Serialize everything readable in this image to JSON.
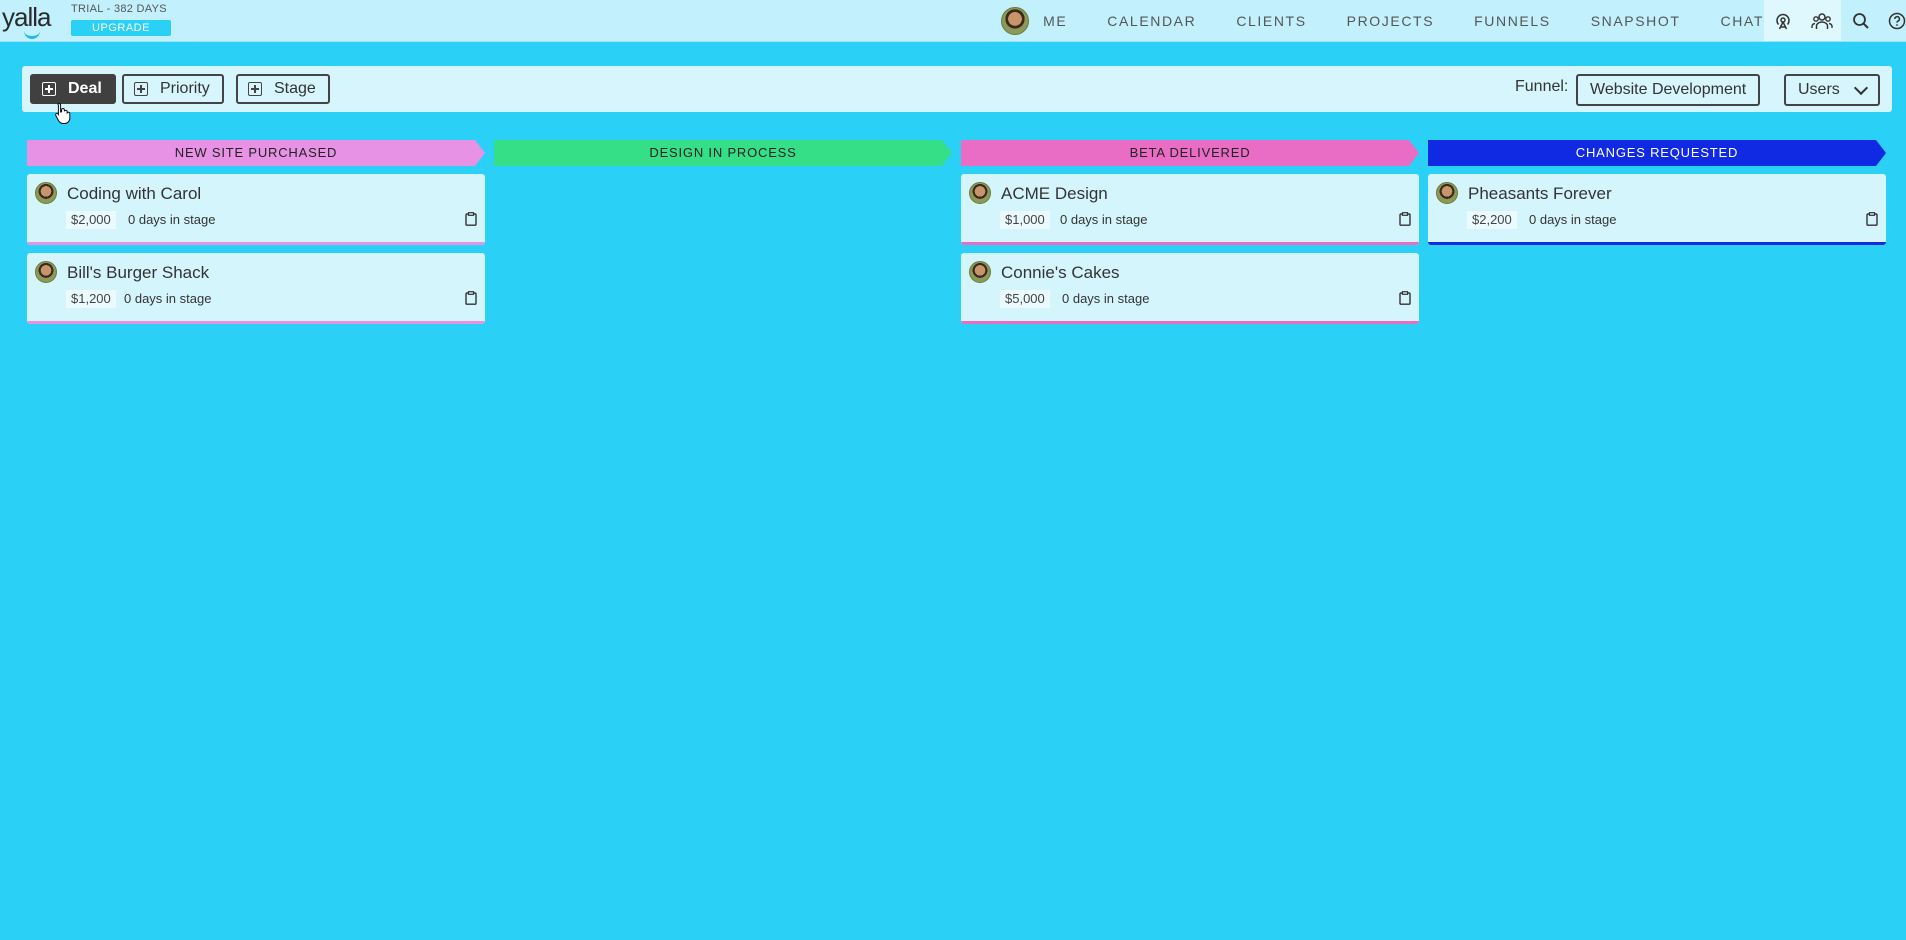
{
  "app": {
    "logo": "yalla",
    "trial": "TRIAL - 382 DAYS",
    "upgrade": "UPGRADE"
  },
  "nav": {
    "items": [
      "ME",
      "CALENDAR",
      "CLIENTS",
      "PROJECTS",
      "FUNNELS",
      "SNAPSHOT",
      "CHAT"
    ],
    "icons": [
      "broadcast-icon",
      "team-icon",
      "search-icon",
      "help-icon"
    ]
  },
  "toolbar": {
    "deal": "Deal",
    "priority": "Priority",
    "stage": "Stage",
    "funnel_label": "Funnel:",
    "funnel_value": "Website Development",
    "users": "Users"
  },
  "stages": [
    {
      "name": "NEW SITE PURCHASED",
      "color": "#e892e6",
      "text_color": "#222222",
      "deals": [
        {
          "title": "Coding with Carol",
          "amount": "$2,000",
          "days": "0 days in stage"
        },
        {
          "title": "Bill's Burger Shack",
          "amount": "$1,200",
          "days": "0 days in stage"
        }
      ]
    },
    {
      "name": "DESIGN IN PROCESS",
      "color": "#35df87",
      "text_color": "#222222",
      "deals": []
    },
    {
      "name": "BETA DELIVERED",
      "color": "#e96dc4",
      "text_color": "#222222",
      "deals": [
        {
          "title": "ACME Design",
          "amount": "$1,000",
          "days": "0 days in stage"
        },
        {
          "title": "Connie's Cakes",
          "amount": "$5,000",
          "days": "0 days in stage"
        }
      ]
    },
    {
      "name": "CHANGES REQUESTED",
      "color": "#1029e3",
      "text_color": "#ffffff",
      "deals": [
        {
          "title": "Pheasants Forever",
          "amount": "$2,200",
          "days": "0 days in stage"
        }
      ]
    }
  ]
}
